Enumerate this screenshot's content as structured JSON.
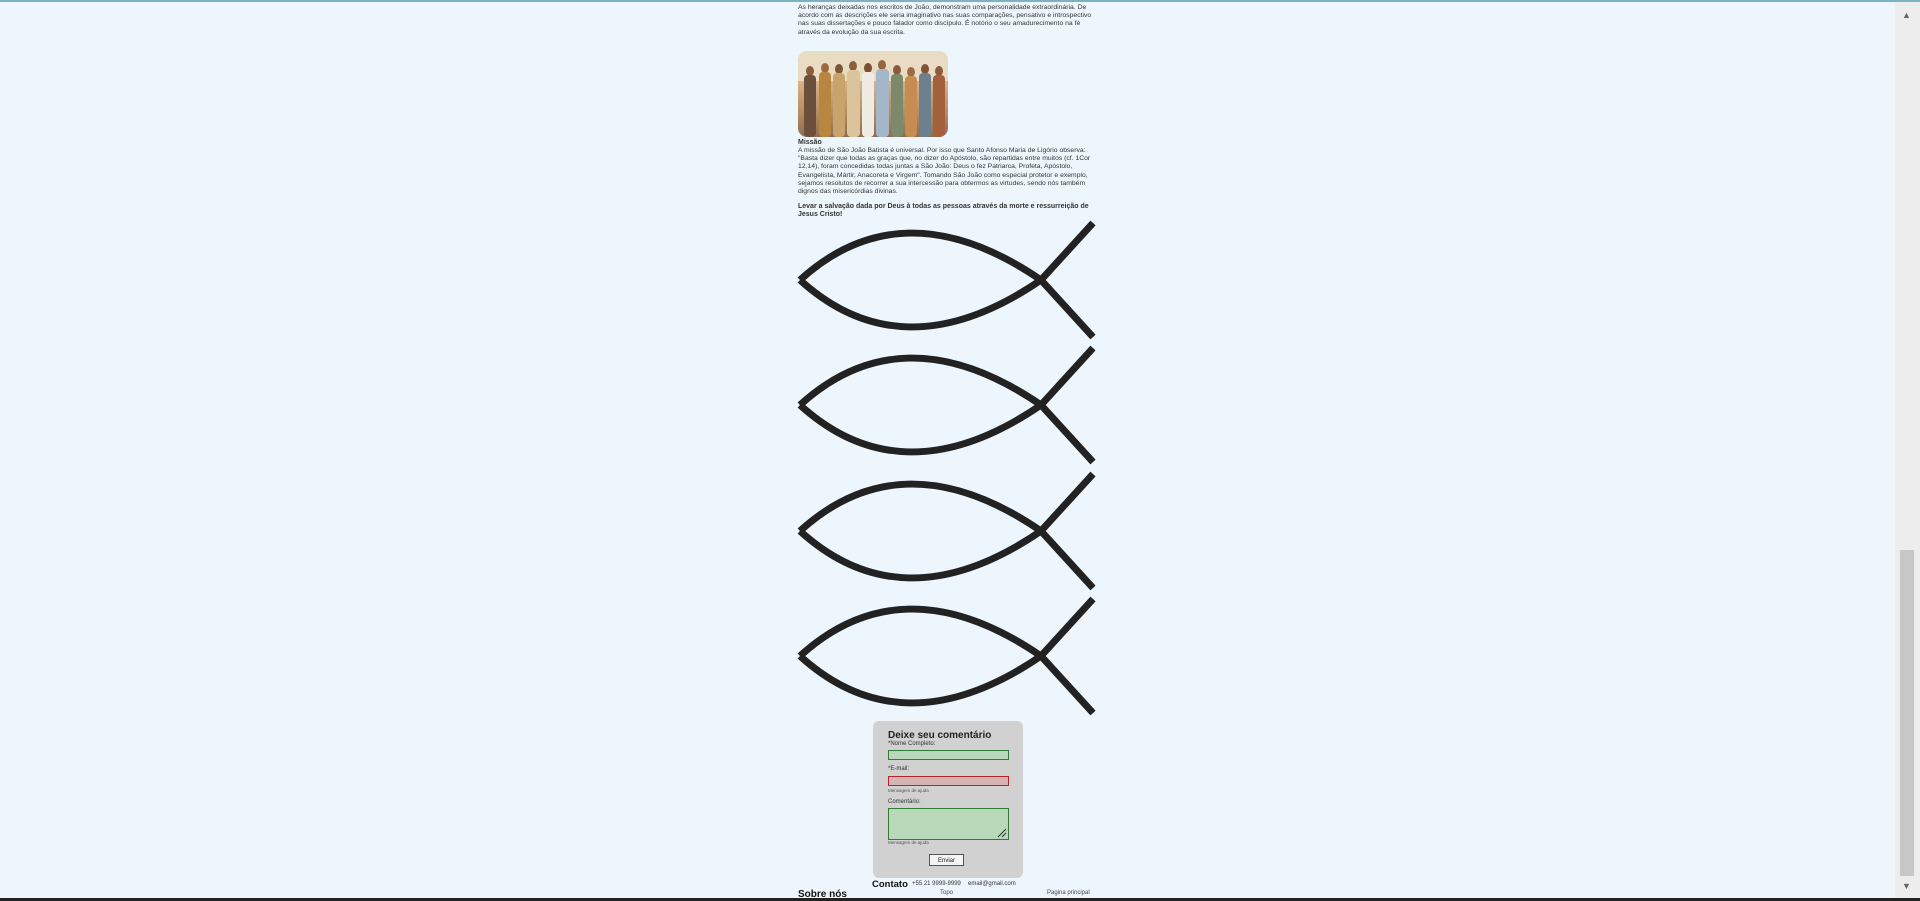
{
  "article": {
    "intro_paragraph": "As heranças deixadas nos escritos de João, demonstram uma personalidade extraordinária. De acordo com as descrições ele seria imaginativo nas suas comparações, pensativo e introspectivo nas suas dissertações e pouco falador como discípulo. É notório o seu amadurecimento na fé através da evolução da sua escrita.",
    "image_description_icon": "apostles-group-painting",
    "mission_heading": "Missão",
    "mission_paragraph": "A missão de São João Batista é universal. Por isso que Santo Afonso Maria de Ligório observa: \"Basta dizer que todas as graças que, no dizer do Apóstolo, são repartidas entre muitos (cf. 1Cor 12,14), foram concedidas todas juntas a São João: Deus o fez Patriarca, Profeta, Apóstolo, Evangelista, Mártir, Anacoreta e Virgem\". Tomando São João como especial protetor e exemplo, sejamos resolutos de recorrer a sua intercessão para obtermos as virtudes, sendo nós também dignos das misericórdias divinas.",
    "mission_statement": "Levar a salvação dada por Deus à todas as pessoas através da morte e ressurreição de Jesus Cristo!",
    "fish_icons": [
      "ichthys-fish-icon",
      "ichthys-fish-icon",
      "ichthys-fish-icon",
      "ichthys-fish-icon"
    ]
  },
  "comment_form": {
    "title": "Deixe seu comentário",
    "name_label": "*Nome Completo:",
    "email_label": "*E-mail:",
    "email_help": "Mensagem de ajuda",
    "comment_label": "Comentário:",
    "comment_help": "Mensagem de ajuda",
    "submit_label": "Enviar"
  },
  "footer": {
    "contact_heading": "Contato",
    "phone": "+55 21 9999-9999",
    "email": "email@gmail.com",
    "about_heading": "Sobre nós",
    "top_link": "Topo",
    "home_link": "Pagina principal"
  },
  "colors": {
    "background": "#eef6fd",
    "valid_field": "#2f7a35",
    "invalid_field": "#b3262c",
    "form_panel": "#d1d1d1"
  }
}
